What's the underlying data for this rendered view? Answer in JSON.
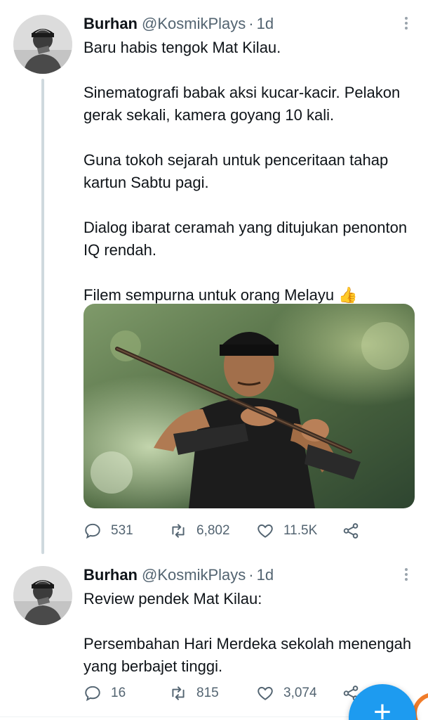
{
  "tweets": [
    {
      "author": {
        "name": "Burhan",
        "handle": "@KosmikPlays",
        "time": "1d",
        "separator": "·"
      },
      "paragraphs": [
        "Baru habis tengok Mat Kilau.",
        "Sinematografi babak aksi kucar-kacir. Pelakon gerak sekali, kamera goyang 10 kali.",
        "Guna tokoh sejarah untuk penceritaan tahap kartun Sabtu pagi.",
        "Dialog ibarat ceramah yang ditujukan penonton IQ rendah.",
        "Filem sempurna untuk orang Melayu"
      ],
      "emoji": "👍",
      "media": {
        "type": "photo",
        "subject": "warrior-with-spear"
      },
      "stats": {
        "replies": "531",
        "retweets": "6,802",
        "likes": "11.5K"
      }
    },
    {
      "author": {
        "name": "Burhan",
        "handle": "@KosmikPlays",
        "time": "1d",
        "separator": "·"
      },
      "paragraphs": [
        "Review pendek Mat Kilau:",
        "Persembahan Hari Merdeka sekolah menengah yang berbajet tinggi."
      ],
      "stats": {
        "replies": "16",
        "retweets": "815",
        "likes": "3,074"
      }
    }
  ],
  "fab": {
    "label": "+"
  },
  "colors": {
    "accent": "#1d9bf0",
    "muted": "#536471",
    "text": "#0f1419",
    "thread_line": "#cfd9de"
  },
  "icons": [
    "reply-icon",
    "retweet-icon",
    "like-icon",
    "share-icon",
    "more-icon",
    "compose-icon"
  ]
}
